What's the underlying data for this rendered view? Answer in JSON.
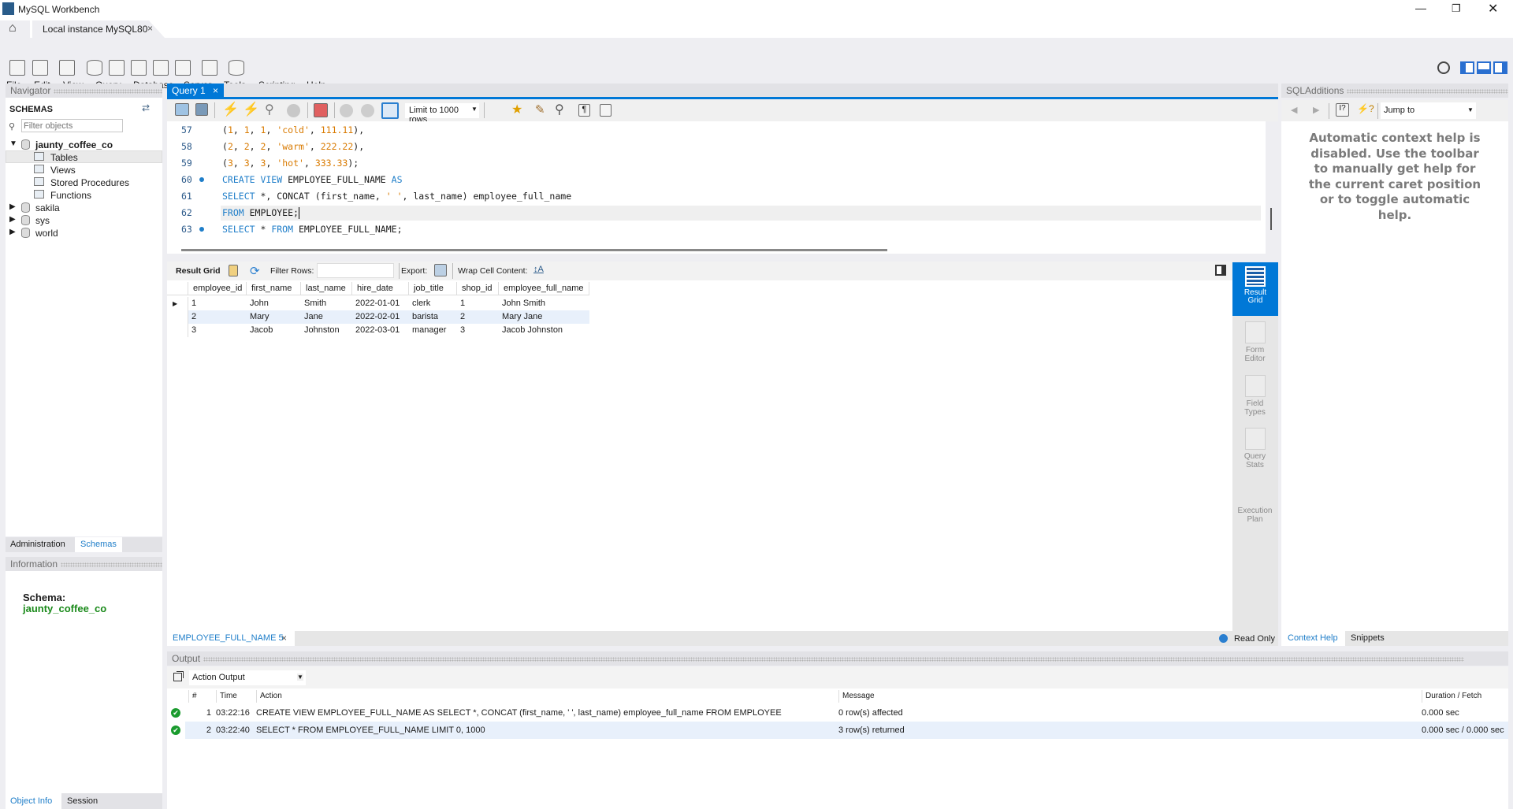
{
  "app": {
    "title": "MySQL Workbench",
    "connection_tab": "Local instance MySQL80"
  },
  "menu": [
    "File",
    "Edit",
    "View",
    "Query",
    "Database",
    "Server",
    "Tools",
    "Scripting",
    "Help"
  ],
  "main_toolbar_icons": [
    "new-sql-tab-icon",
    "open-sql-script-icon",
    "schema-inspector-icon",
    "create-schema-icon",
    "create-table-icon",
    "create-view-icon",
    "create-procedure-icon",
    "create-function-icon",
    "search-table-data-icon",
    "reconnect-icon"
  ],
  "navigator": {
    "header": "Navigator",
    "schemas_title": "SCHEMAS",
    "filter_placeholder": "Filter objects",
    "tree": [
      {
        "name": "jaunty_coffee_co",
        "expanded": true,
        "children": [
          "Tables",
          "Views",
          "Stored Procedures",
          "Functions"
        ],
        "selected_child": "Tables"
      },
      {
        "name": "sakila"
      },
      {
        "name": "sys"
      },
      {
        "name": "world"
      }
    ],
    "tabs": [
      "Administration",
      "Schemas"
    ],
    "active_tab": "Schemas"
  },
  "information": {
    "header": "Information",
    "schema_label": "Schema:",
    "schema_value": "jaunty_coffee_co",
    "tabs": [
      "Object Info",
      "Session"
    ],
    "active_tab": "Object Info"
  },
  "query_tab": {
    "label": "Query 1",
    "limit": "Limit to 1000 rows"
  },
  "editor": {
    "lines": [
      {
        "n": "57",
        "dot": false,
        "tokens": [
          [
            "p",
            "("
          ],
          [
            "num",
            "1"
          ],
          [
            "p",
            ", "
          ],
          [
            "num",
            "1"
          ],
          [
            "p",
            ", "
          ],
          [
            "num",
            "1"
          ],
          [
            "p",
            ", "
          ],
          [
            "str",
            "'cold'"
          ],
          [
            "p",
            ", "
          ],
          [
            "num",
            "111.11"
          ],
          [
            "p",
            "),"
          ]
        ]
      },
      {
        "n": "58",
        "dot": false,
        "tokens": [
          [
            "p",
            "("
          ],
          [
            "num",
            "2"
          ],
          [
            "p",
            ", "
          ],
          [
            "num",
            "2"
          ],
          [
            "p",
            ", "
          ],
          [
            "num",
            "2"
          ],
          [
            "p",
            ", "
          ],
          [
            "str",
            "'warm'"
          ],
          [
            "p",
            ", "
          ],
          [
            "num",
            "222.22"
          ],
          [
            "p",
            "),"
          ]
        ]
      },
      {
        "n": "59",
        "dot": false,
        "tokens": [
          [
            "p",
            "("
          ],
          [
            "num",
            "3"
          ],
          [
            "p",
            ", "
          ],
          [
            "num",
            "3"
          ],
          [
            "p",
            ", "
          ],
          [
            "num",
            "3"
          ],
          [
            "p",
            ", "
          ],
          [
            "str",
            "'hot'"
          ],
          [
            "p",
            ", "
          ],
          [
            "num",
            "333.33"
          ],
          [
            "p",
            ");"
          ]
        ]
      },
      {
        "n": "60",
        "dot": true,
        "tokens": [
          [
            "kw",
            "CREATE VIEW"
          ],
          [
            "p",
            " EMPLOYEE_FULL_NAME "
          ],
          [
            "kw",
            "AS"
          ]
        ]
      },
      {
        "n": "61",
        "dot": false,
        "tokens": [
          [
            "kw",
            "SELECT"
          ],
          [
            "p",
            " *, CONCAT (first_name, "
          ],
          [
            "str",
            "' '"
          ],
          [
            "p",
            ", last_name) employee_full_name"
          ]
        ]
      },
      {
        "n": "62",
        "dot": false,
        "tokens": [
          [
            "kw",
            "FROM"
          ],
          [
            "p",
            " EMPLOYEE;"
          ]
        ]
      },
      {
        "n": "63",
        "dot": true,
        "tokens": [
          [
            "kw",
            "SELECT"
          ],
          [
            "p",
            " * "
          ],
          [
            "kw",
            "FROM"
          ],
          [
            "p",
            " EMPLOYEE_FULL_NAME;"
          ]
        ]
      }
    ]
  },
  "result_toolbar": {
    "result_grid": "Result Grid",
    "filter_rows": "Filter Rows:",
    "filter_value": "",
    "export": "Export:",
    "wrap": "Wrap Cell Content:"
  },
  "result_grid": {
    "columns": [
      "employee_id",
      "first_name",
      "last_name",
      "hire_date",
      "job_title",
      "shop_id",
      "employee_full_name"
    ],
    "rows": [
      [
        "1",
        "John",
        "Smith",
        "2022-01-01",
        "clerk",
        "1",
        "John Smith"
      ],
      [
        "2",
        "Mary",
        "Jane",
        "2022-02-01",
        "barista",
        "2",
        "Mary Jane"
      ],
      [
        "3",
        "Jacob",
        "Johnston",
        "2022-03-01",
        "manager",
        "3",
        "Jacob Johnston"
      ]
    ]
  },
  "side_tabs": [
    {
      "l1": "Result",
      "l2": "Grid",
      "active": true
    },
    {
      "l1": "Form",
      "l2": "Editor"
    },
    {
      "l1": "Field",
      "l2": "Types"
    },
    {
      "l1": "Query",
      "l2": "Stats"
    },
    {
      "l1": "Execution",
      "l2": "Plan"
    }
  ],
  "result_tab": {
    "label": "EMPLOYEE_FULL_NAME 5",
    "read_only": "Read Only"
  },
  "sql_additions": {
    "header": "SQLAdditions",
    "jump_to": "Jump to",
    "help_text": "Automatic context help is disabled. Use the toolbar to manually get help for the current caret position or to toggle automatic help.",
    "tabs": [
      "Context Help",
      "Snippets"
    ],
    "active_tab": "Context Help"
  },
  "output": {
    "header": "Output",
    "selector": "Action Output",
    "columns": [
      "#",
      "Time",
      "Action",
      "Message",
      "Duration / Fetch"
    ],
    "rows": [
      {
        "n": "1",
        "time": "03:22:16",
        "action": "CREATE VIEW EMPLOYEE_FULL_NAME AS SELECT *, CONCAT (first_name, ' ', last_name) employee_full_name  FROM EMPLOYEE",
        "message": "0 row(s) affected",
        "duration": "0.000 sec",
        "status": "success"
      },
      {
        "n": "2",
        "time": "03:22:40",
        "action": "SELECT * FROM EMPLOYEE_FULL_NAME LIMIT 0, 1000",
        "message": "3 row(s) returned",
        "duration": "0.000 sec / 0.000 sec",
        "status": "success"
      }
    ]
  },
  "colors": {
    "accent": "#0078d7",
    "schema_green": "#1a8a1a",
    "keyword": "#1f7ec9",
    "number": "#d97a00"
  }
}
